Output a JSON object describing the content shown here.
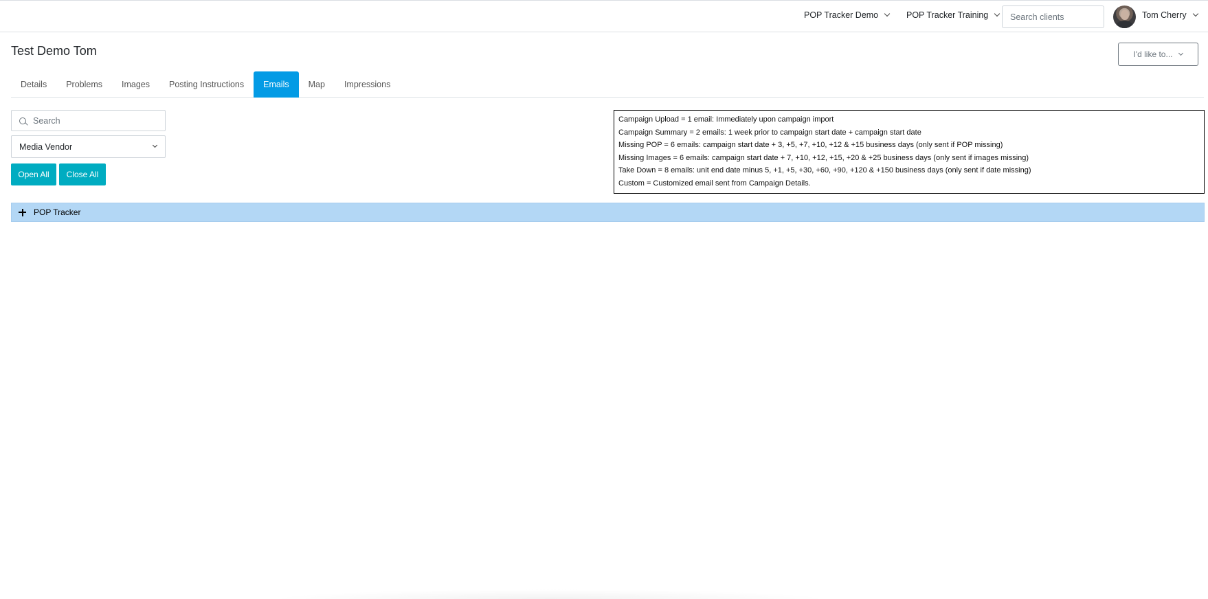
{
  "navbar": {
    "org_dropdown": "POP Tracker Demo",
    "training_dropdown": "POP Tracker Training",
    "client_search_placeholder": "Search clients",
    "user_name": "Tom Cherry"
  },
  "page": {
    "title": "Test Demo Tom",
    "action_button": "I'd like to..."
  },
  "tabs": [
    {
      "label": "Details"
    },
    {
      "label": "Problems"
    },
    {
      "label": "Images"
    },
    {
      "label": "Posting Instructions"
    },
    {
      "label": "Emails",
      "active": true
    },
    {
      "label": "Map"
    },
    {
      "label": "Impressions"
    }
  ],
  "filters": {
    "search_placeholder": "Search",
    "vendor_select": "Media Vendor",
    "open_all": "Open All",
    "close_all": "Close All"
  },
  "legend": [
    "Campaign Upload = 1 email: Immediately upon campaign import",
    "Campaign Summary = 2 emails: 1 week prior to campaign start date + campaign start date",
    "Missing POP = 6 emails: campaign start date + 3, +5, +7, +10, +12 & +15 business days (only sent if POP missing)",
    "Missing Images = 6 emails: campaign start date + 7, +10, +12, +15, +20 & +25 business days (only sent if images missing)",
    "Take Down = 8 emails: unit end date minus 5, +1, +5, +30, +60, +90, +120 & +150 business days (only sent if date missing)",
    "Custom = Customized email sent from Campaign Details."
  ],
  "accordion": {
    "label": "POP Tracker",
    "expanded": false
  },
  "colors": {
    "active_tab": "#039be5",
    "teal_button": "#00acc1",
    "accordion_bg": "#b3d7f5"
  }
}
